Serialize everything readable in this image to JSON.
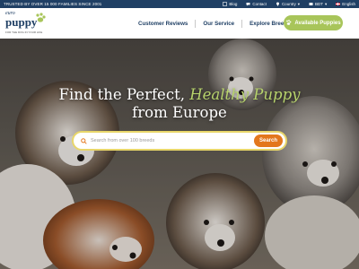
{
  "topbar": {
    "trust_text": "TRUSTED BY OVER 15 000 FAMILIES SINCE 2001",
    "blog": "Blog",
    "contact": "Contact",
    "country": "Country",
    "currency": "BDT",
    "language": "English"
  },
  "logo": {
    "euro": "euro",
    "puppy": "puppy",
    "tagline": "FOR THE DOG IN YOUR LIFE"
  },
  "nav": {
    "items": [
      "Customer Reviews",
      "Our Service",
      "Explore Breeds"
    ],
    "cta_label": "Available Puppies"
  },
  "hero": {
    "headline_line1": "Find the Perfect,",
    "headline_accent": "Healthy Puppy",
    "headline_line2": "from Europe"
  },
  "search": {
    "placeholder": "Search from over 100 breeds",
    "button_label": "Search"
  },
  "colors": {
    "topbar": "#1f3f64",
    "navy": "#1f3f64",
    "green": "#a8c55a",
    "accent_text": "#b7d36c",
    "search_button": "#e3771d"
  }
}
